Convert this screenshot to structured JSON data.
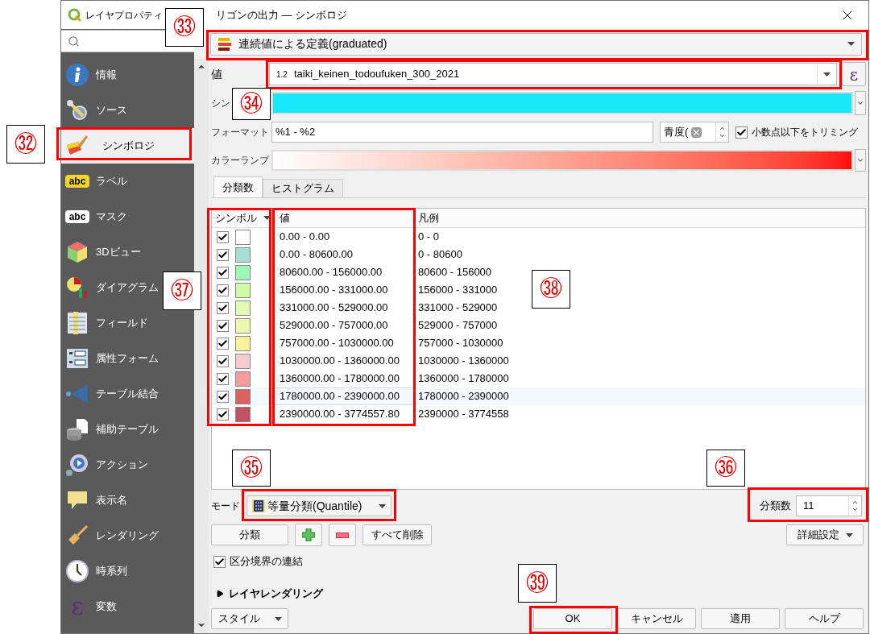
{
  "window": {
    "title_start": "レイヤプロパティ",
    "title_end": "リゴンの出力 — シンボロジ"
  },
  "sidebar": {
    "items": [
      {
        "label": "情報",
        "selected": false
      },
      {
        "label": "ソース",
        "selected": false
      },
      {
        "label": "シンボロジ",
        "selected": true
      },
      {
        "label": "ラベル",
        "selected": false,
        "badge": "abc"
      },
      {
        "label": "マスク",
        "selected": false,
        "badge": "abc"
      },
      {
        "label": "3Dビュー",
        "selected": false
      },
      {
        "label": "ダイアグラム",
        "selected": false
      },
      {
        "label": "フィールド",
        "selected": false
      },
      {
        "label": "属性フォーム",
        "selected": false
      },
      {
        "label": "テーブル結合",
        "selected": false
      },
      {
        "label": "補助テーブル",
        "selected": false
      },
      {
        "label": "アクション",
        "selected": false
      },
      {
        "label": "表示名",
        "selected": false
      },
      {
        "label": "レンダリング",
        "selected": false
      },
      {
        "label": "時系列",
        "selected": false
      },
      {
        "label": "変数",
        "selected": false,
        "badge": "ε"
      }
    ]
  },
  "renderer": "連続値による定義(graduated)",
  "value_field": {
    "label": "値",
    "type_badge": "1.2",
    "value": "taiki_keinen_todoufuken_300_2021",
    "expression_button": "ε"
  },
  "symbol_label": "シン",
  "format": {
    "label": "フォーマット",
    "value": "%1 - %2",
    "precision": "青度(",
    "trim_label": "小数点以下をトリミング",
    "trim_checked": true
  },
  "color_ramp": {
    "label": "カラーランプ"
  },
  "tabs": [
    {
      "label": "分類数",
      "selected": true
    },
    {
      "label": "ヒストグラム",
      "selected": false
    }
  ],
  "table": {
    "columns": [
      "シンボル",
      "値",
      "凡例"
    ],
    "rows": [
      {
        "checked": true,
        "color": "#ffffff",
        "value": "0.00 - 0.00",
        "legend": "0 - 0",
        "selected": false
      },
      {
        "checked": true,
        "color": "#a9ded4",
        "value": "0.00 - 80600.00",
        "legend": "0 - 80600",
        "selected": false
      },
      {
        "checked": true,
        "color": "#9ef7b6",
        "value": "80600.00 - 156000.00",
        "legend": "80600 - 156000",
        "selected": false
      },
      {
        "checked": true,
        "color": "#cff9a6",
        "value": "156000.00 - 331000.00",
        "legend": "156000 - 331000",
        "selected": false
      },
      {
        "checked": true,
        "color": "#e1fab6",
        "value": "331000.00 - 529000.00",
        "legend": "331000 - 529000",
        "selected": false
      },
      {
        "checked": true,
        "color": "#eef7ae",
        "value": "529000.00 - 757000.00",
        "legend": "529000 - 757000",
        "selected": false
      },
      {
        "checked": true,
        "color": "#f9f29c",
        "value": "757000.00 - 1030000.00",
        "legend": "757000 - 1030000",
        "selected": false
      },
      {
        "checked": true,
        "color": "#f7cccc",
        "value": "1030000.00 - 1360000.00",
        "legend": "1030000 - 1360000",
        "selected": false
      },
      {
        "checked": true,
        "color": "#f59b9b",
        "value": "1360000.00 - 1780000.00",
        "legend": "1360000 - 1780000",
        "selected": false
      },
      {
        "checked": true,
        "color": "#dc6262",
        "value": "1780000.00 - 2390000.00",
        "legend": "1780000 - 2390000",
        "selected": true
      },
      {
        "checked": true,
        "color": "#c05262",
        "value": "2390000.00 - 3774557.80",
        "legend": "2390000 - 3774558",
        "selected": false
      }
    ]
  },
  "mode": {
    "label": "モード",
    "value": "等量分類(Quantile)"
  },
  "classes": {
    "label": "分類数",
    "value": "11"
  },
  "action_buttons": {
    "classify": "分類",
    "delete_all": "すべて削除",
    "advanced": "詳細設定"
  },
  "link_boundaries": {
    "label": "区分境界の連結",
    "checked": true
  },
  "layer_rendering": {
    "label": "レイヤレンダリング",
    "expanded": false
  },
  "style_button": "スタイル",
  "dialog_buttons": [
    "OK",
    "キャンセル",
    "適用",
    "ヘルプ"
  ],
  "callouts": [
    "㉜",
    "㉝",
    "㉞",
    "㉟",
    "㊱",
    "㊲",
    "㊳",
    "㊴"
  ]
}
